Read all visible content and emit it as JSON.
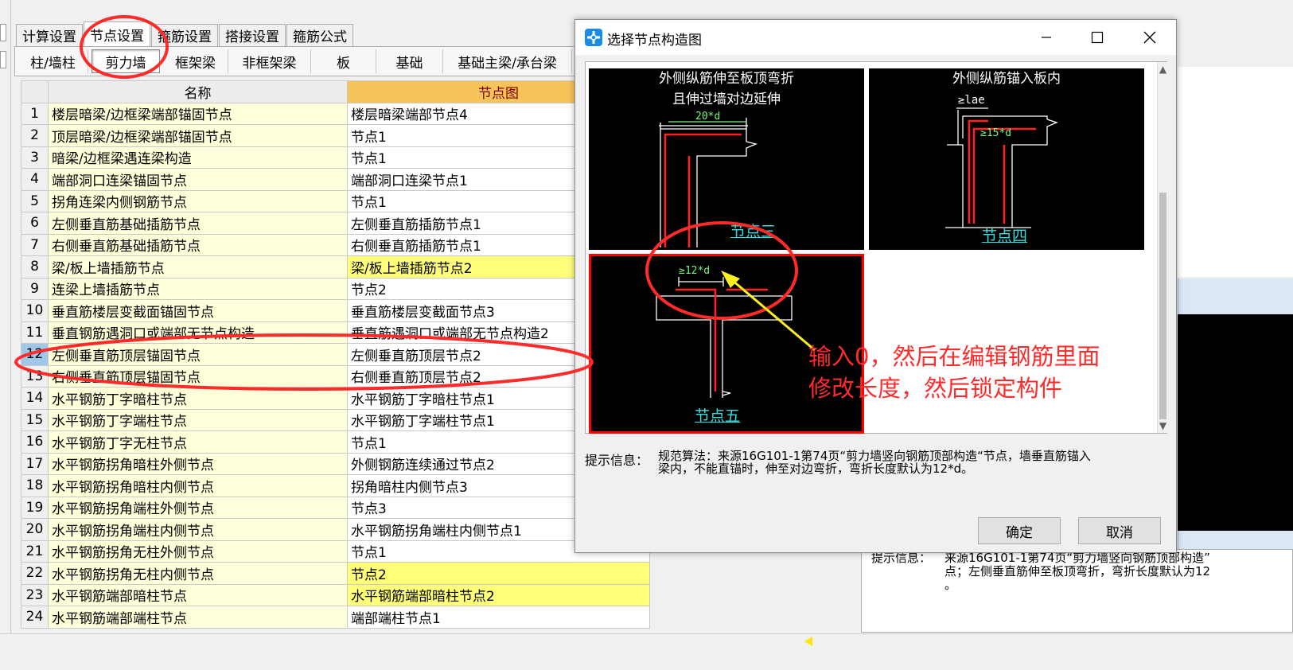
{
  "main": {
    "top_tabs": [
      "计算设置",
      "节点设置",
      "箍筋设置",
      "搭接设置",
      "箍筋公式"
    ],
    "active_top_tab": 1,
    "sub_tabs": [
      "柱/墙柱",
      "剪力墙",
      "框架梁",
      "非框架梁",
      "板",
      "基础",
      "基础主梁/承台梁"
    ],
    "active_sub_tab": 1,
    "grid": {
      "columns": [
        "名称",
        "节点图"
      ],
      "rows": [
        {
          "no": "1",
          "name": "楼层暗梁/边框梁端部锚固节点",
          "node": "楼层暗梁端部节点4",
          "hl": false
        },
        {
          "no": "2",
          "name": "顶层暗梁/边框梁端部锚固节点",
          "node": "节点1",
          "hl": false
        },
        {
          "no": "3",
          "name": "暗梁/边框梁遇连梁构造",
          "node": "节点1",
          "hl": false
        },
        {
          "no": "4",
          "name": "端部洞口连梁锚固节点",
          "node": "端部洞口连梁节点1",
          "hl": false
        },
        {
          "no": "5",
          "name": "拐角连梁内侧钢筋节点",
          "node": "节点1",
          "hl": false
        },
        {
          "no": "6",
          "name": "左侧垂直筋基础插筋节点",
          "node": "左侧垂直筋插筋节点1",
          "hl": false
        },
        {
          "no": "7",
          "name": "右侧垂直筋基础插筋节点",
          "node": "右侧垂直筋插筋节点1",
          "hl": false
        },
        {
          "no": "8",
          "name": "梁/板上墙插筋节点",
          "node": "梁/板上墙插筋节点2",
          "hl": true
        },
        {
          "no": "9",
          "name": "连梁上墙插筋节点",
          "node": "节点2",
          "hl": false
        },
        {
          "no": "10",
          "name": "垂直筋楼层变截面锚固节点",
          "node": "垂直筋楼层变截面节点3",
          "hl": false
        },
        {
          "no": "11",
          "name": "垂直钢筋遇洞口或端部无节点构造",
          "node": "垂直筋遇洞口或端部无节点构造2",
          "hl": false
        },
        {
          "no": "12",
          "name": "左侧垂直筋顶层锚固节点",
          "node": "左侧垂直筋顶层节点2",
          "hl": false
        },
        {
          "no": "13",
          "name": "右侧垂直筋顶层锚固节点",
          "node": "右侧垂直筋顶层节点2",
          "hl": false
        },
        {
          "no": "14",
          "name": "水平钢筋丁字暗柱节点",
          "node": "水平钢筋丁字暗柱节点1",
          "hl": false
        },
        {
          "no": "15",
          "name": "水平钢筋丁字端柱节点",
          "node": "水平钢筋丁字端柱节点1",
          "hl": false
        },
        {
          "no": "16",
          "name": "水平钢筋丁字无柱节点",
          "node": "节点1",
          "hl": false
        },
        {
          "no": "17",
          "name": "水平钢筋拐角暗柱外侧节点",
          "node": "外侧钢筋连续通过节点2",
          "hl": false
        },
        {
          "no": "18",
          "name": "水平钢筋拐角暗柱内侧节点",
          "node": "拐角暗柱内侧节点3",
          "hl": false
        },
        {
          "no": "19",
          "name": "水平钢筋拐角端柱外侧节点",
          "node": "节点3",
          "hl": false
        },
        {
          "no": "20",
          "name": "水平钢筋拐角端柱内侧节点",
          "node": "水平钢筋拐角端柱内侧节点1",
          "hl": false
        },
        {
          "no": "21",
          "name": "水平钢筋拐角无柱外侧节点",
          "node": "节点1",
          "hl": false
        },
        {
          "no": "22",
          "name": "水平钢筋拐角无柱内侧节点",
          "node": "节点2",
          "hl": true
        },
        {
          "no": "23",
          "name": "水平钢筋端部暗柱节点",
          "node": "水平钢筋端部暗柱节点2",
          "hl": true
        },
        {
          "no": "24",
          "name": "水平钢筋端部端柱节点",
          "node": "端部端柱节点1",
          "hl": false
        }
      ],
      "selected_row": 11
    },
    "hint": {
      "label": "提示信息：",
      "text": "来源16G101-1第74页“剪力墙竖向钢筋顶部构造”\n点；左侧垂直筋伸至板顶弯折，弯折长度默认为12\n。"
    }
  },
  "dialog": {
    "title": "选择节点构造图",
    "thumbs": [
      {
        "title": "外侧纵筋伸至板顶弯折\n且伸过墙对边延伸",
        "dim": "20*d",
        "caption": "节点三"
      },
      {
        "title": "外侧纵筋锚入板内",
        "dim1": "≥lae",
        "dim2": "≥15*d",
        "caption": "节点四"
      },
      {
        "title": "",
        "dim": "≥12*d",
        "caption": "节点五"
      }
    ],
    "hint_label": "提示信息：",
    "hint_text": "规范算法：来源16G101-1第74页“剪力墙竖向钢筋顶部构造“节点，墙垂直筋锚入\n梁内，不能直锚时，伸至对边弯折，弯折长度默认为12*d。",
    "ok": "确定",
    "cancel": "取消"
  },
  "annotation": {
    "note": "输入0，然后在编辑钢筋里面\n修改长度，然后锁定构件",
    "color": "#ff2a2a"
  }
}
